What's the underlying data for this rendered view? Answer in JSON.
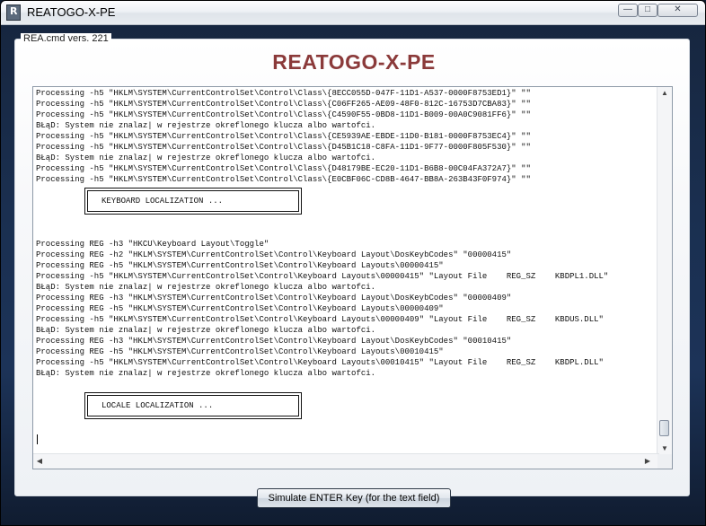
{
  "window": {
    "title": "REATOGO-X-PE",
    "icon_label": "R"
  },
  "controls": {
    "minimize": "—",
    "maximize": "□",
    "close": "✕"
  },
  "group": {
    "label": "REA.cmd vers. 221"
  },
  "header": {
    "title": "REATOGO-X-PE"
  },
  "console": {
    "block1": [
      "Processing -h5 \"HKLM\\SYSTEM\\CurrentControlSet\\Control\\Class\\{8ECC055D-047F-11D1-A537-0000F8753ED1}\" \"\"",
      "Processing -h5 \"HKLM\\SYSTEM\\CurrentControlSet\\Control\\Class\\{C06FF265-AE09-48F0-812C-16753D7CBA83}\" \"\"",
      "Processing -h5 \"HKLM\\SYSTEM\\CurrentControlSet\\Control\\Class\\{C4590F55-0BD8-11D1-B009-00A0C9081FF6}\" \"\"",
      "BŁąD: System nie znalaz| w rejestrze okreflonego klucza albo wartofci.",
      "Processing -h5 \"HKLM\\SYSTEM\\CurrentControlSet\\Control\\Class\\{CE5939AE-EBDE-11D0-B181-0000F8753EC4}\" \"\"",
      "Processing -h5 \"HKLM\\SYSTEM\\CurrentControlSet\\Control\\Class\\{D45B1C18-C8FA-11D1-9F77-0000F805F530}\" \"\"",
      "BŁąD: System nie znalaz| w rejestrze okreflonego klucza albo wartofci.",
      "Processing -h5 \"HKLM\\SYSTEM\\CurrentControlSet\\Control\\Class\\{D48179BE-EC20-11D1-B6B8-00C04FA372A7}\" \"\"",
      "Processing -h5 \"HKLM\\SYSTEM\\CurrentControlSet\\Control\\Class\\{E0CBF06C-CD8B-4647-BB8A-263B43F0F974}\" \"\""
    ],
    "banner1": "KEYBOARD LOCALIZATION ...",
    "block2": [
      "Processing REG -h3 \"HKCU\\Keyboard Layout\\Toggle\"",
      "Processing REG -h2 \"HKLM\\SYSTEM\\CurrentControlSet\\Control\\Keyboard Layout\\DosKeybCodes\" \"00000415\"",
      "Processing REG -h5 \"HKLM\\SYSTEM\\CurrentControlSet\\Control\\Keyboard Layouts\\00000415\"",
      "Processing -h5 \"HKLM\\SYSTEM\\CurrentControlSet\\Control\\Keyboard Layouts\\00000415\" \"Layout File    REG_SZ    KBDPL1.DLL\"",
      "BŁąD: System nie znalaz| w rejestrze okreflonego klucza albo wartofci.",
      "Processing REG -h3 \"HKLM\\SYSTEM\\CurrentControlSet\\Control\\Keyboard Layout\\DosKeybCodes\" \"00000409\"",
      "Processing REG -h5 \"HKLM\\SYSTEM\\CurrentControlSet\\Control\\Keyboard Layouts\\00000409\"",
      "Processing -h5 \"HKLM\\SYSTEM\\CurrentControlSet\\Control\\Keyboard Layouts\\00000409\" \"Layout File    REG_SZ    KBDUS.DLL\"",
      "BŁąD: System nie znalaz| w rejestrze okreflonego klucza albo wartofci.",
      "Processing REG -h3 \"HKLM\\SYSTEM\\CurrentControlSet\\Control\\Keyboard Layout\\DosKeybCodes\" \"00010415\"",
      "Processing REG -h5 \"HKLM\\SYSTEM\\CurrentControlSet\\Control\\Keyboard Layouts\\00010415\"",
      "Processing -h5 \"HKLM\\SYSTEM\\CurrentControlSet\\Control\\Keyboard Layouts\\00010415\" \"Layout File    REG_SZ    KBDPL.DLL\"",
      "BŁąD: System nie znalaz| w rejestrze okreflonego klucza albo wartofci."
    ],
    "banner2": "LOCALE LOCALIZATION ..."
  },
  "scroll": {
    "up": "▲",
    "down": "▼",
    "left": "◀",
    "right": "▶"
  },
  "footer": {
    "enter_button": "Simulate ENTER Key  (for the text field)"
  }
}
